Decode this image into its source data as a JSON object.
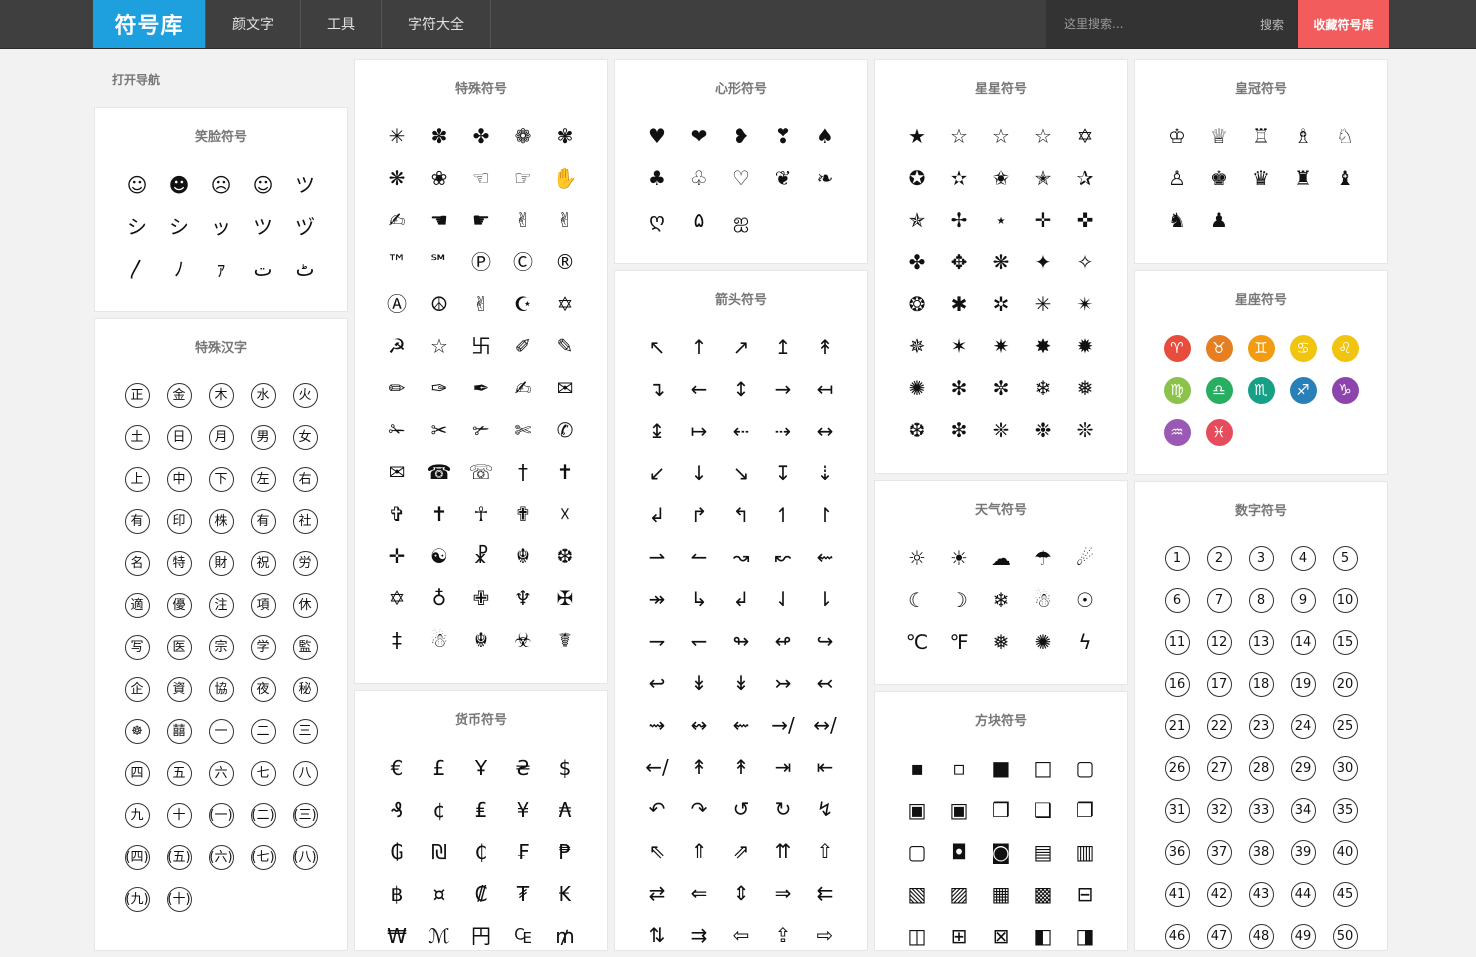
{
  "header": {
    "logo": "符号库",
    "nav": [
      "颜文字",
      "工具",
      "字符大全"
    ],
    "search_placeholder": "这里搜索...",
    "search_button": "搜索",
    "favorite": "收藏符号库"
  },
  "open_nav": "打开导航",
  "colors": {
    "logo_bg": "#1e9fde",
    "favorite_bg": "#f25c5c",
    "topbar_bg": "#3f3f3f",
    "zodiac": [
      "#e74c3c",
      "#e67e22",
      "#f39c12",
      "#f1c40f",
      "#f1c40f",
      "#8bc34a",
      "#27ae60",
      "#16a085",
      "#2980b9",
      "#8e44ad",
      "#9b59b6",
      "#e74c5c"
    ]
  },
  "panels": {
    "smile": {
      "title": "笑脸符号",
      "symbols": [
        "☺",
        "☻",
        "☹",
        "☺",
        "ツ",
        "シ",
        "シ",
        "ッ",
        "ツ",
        "ヅ",
        "〳",
        "ﾉ",
        "ｧ",
        "ت",
        "ٹ"
      ]
    },
    "chinese": {
      "title": "特殊汉字",
      "symbols": [
        "正",
        "金",
        "木",
        "水",
        "火",
        "土",
        "日",
        "月",
        "男",
        "女",
        "上",
        "中",
        "下",
        "左",
        "右",
        "有",
        "印",
        "株",
        "有",
        "社",
        "名",
        "特",
        "財",
        "祝",
        "労",
        "適",
        "優",
        "注",
        "項",
        "休",
        "写",
        "医",
        "宗",
        "学",
        "監",
        "企",
        "資",
        "協",
        "夜",
        "秘",
        "☸",
        "囍",
        "一",
        "二",
        "三",
        "四",
        "五",
        "六",
        "七",
        "八",
        "九",
        "十",
        "(一)",
        "(二)",
        "(三)",
        "(四)",
        "(五)",
        "(六)",
        "(七)",
        "(八)",
        "(九)",
        "(十)"
      ]
    },
    "special": {
      "title": "特殊符号",
      "symbols": [
        "✳",
        "✽",
        "✤",
        "❁",
        "✾",
        "❋",
        "❀",
        "☜",
        "☞",
        "✋",
        "✍",
        "☚",
        "☛",
        "✌",
        "✌",
        "™",
        "℠",
        "Ⓟ",
        "Ⓒ",
        "®",
        "Ⓐ",
        "☮",
        "✌",
        "☪",
        "✡",
        "☭",
        "☆",
        "卐",
        "✐",
        "✎",
        "✏",
        "✑",
        "✒",
        "✍",
        "✉",
        "✁",
        "✂",
        "✃",
        "✄",
        "✆",
        "✉",
        "☎",
        "☏",
        "†",
        "✝",
        "✞",
        "✝",
        "☥",
        "✟",
        "☓",
        "✛",
        "☯",
        "☧",
        "☬",
        "❆",
        "✡",
        "♁",
        "✙",
        "♆",
        "✠",
        "‡",
        "☃",
        "☬",
        "☣",
        "☤"
      ]
    },
    "heart": {
      "title": "心形符号",
      "symbols": [
        "♥",
        "❤",
        "❥",
        "❣",
        "♠",
        "♣",
        "♧",
        "♡",
        "❦",
        "❧",
        "ღ",
        "۵",
        "ஐ"
      ]
    },
    "arrow": {
      "title": "箭头符号",
      "symbols": [
        "↖",
        "↑",
        "↗",
        "↥",
        "↟",
        "↴",
        "←",
        "↕",
        "→",
        "↤",
        "↨",
        "↦",
        "⇠",
        "⇢",
        "↔",
        "↙",
        "↓",
        "↘",
        "↧",
        "⇣",
        "↲",
        "↱",
        "↰",
        "↿",
        "↾",
        "⇀",
        "↼",
        "↝",
        "↜",
        "⇜",
        "↠",
        "↳",
        "↲",
        "⇃",
        "⇂",
        "⇁",
        "↽",
        "↬",
        "↫",
        "↪",
        "↩",
        "↡",
        "↡",
        "↣",
        "↢",
        "⇝",
        "↭",
        "⇜",
        "→/",
        "↔/",
        "←/",
        "↟",
        "↟",
        "⇥",
        "⇤",
        "↶",
        "↷",
        "↺",
        "↻",
        "↯",
        "⇖",
        "⇑",
        "⇗",
        "⇈",
        "⇧",
        "⇄",
        "⇐",
        "⇕",
        "⇒",
        "⇇",
        "⇅",
        "⇉",
        "⇦",
        "⇪",
        "⇨"
      ]
    },
    "star": {
      "title": "星星符号",
      "symbols": [
        "★",
        "☆",
        "☆",
        "☆",
        "✡",
        "✪",
        "✫",
        "✬",
        "✭",
        "✰",
        "✯",
        "✢",
        "⋆",
        "✛",
        "✜",
        "✤",
        "✥",
        "❋",
        "✦",
        "✧",
        "❂",
        "✱",
        "✲",
        "✳",
        "✴",
        "✵",
        "✶",
        "✷",
        "✸",
        "✹",
        "✺",
        "✻",
        "✼",
        "❄",
        "❅",
        "❆",
        "❇",
        "❈",
        "❉",
        "❊"
      ]
    },
    "crown": {
      "title": "皇冠符号",
      "symbols": [
        "♔",
        "♕",
        "♖",
        "♗",
        "♘",
        "♙",
        "♚",
        "♛",
        "♜",
        "♝",
        "♞",
        "♟"
      ]
    },
    "zodiac": {
      "title": "星座符号",
      "symbols": [
        "♈",
        "♉",
        "♊",
        "♋",
        "♌",
        "♍",
        "♎",
        "♏",
        "♐",
        "♑",
        "♒",
        "♓"
      ]
    },
    "weather": {
      "title": "天气符号",
      "symbols": [
        "☼",
        "☀",
        "☁",
        "☂",
        "☄",
        "☾",
        "☽",
        "❄",
        "☃",
        "☉",
        "℃",
        "℉",
        "❅",
        "✺",
        "ϟ"
      ]
    },
    "currency": {
      "title": "货币符号",
      "symbols": [
        "€",
        "£",
        "Ұ",
        "₴",
        "$",
        "₰",
        "¢",
        "₤",
        "¥",
        "₳",
        "₲",
        "₪",
        "₵",
        "₣",
        "₱",
        "฿",
        "¤",
        "₡",
        "₮",
        "₭",
        "₩",
        "ℳ",
        "円",
        "₠",
        "₥"
      ]
    },
    "number": {
      "title": "数字符号",
      "symbols": [
        "1",
        "2",
        "3",
        "4",
        "5",
        "6",
        "7",
        "8",
        "9",
        "10",
        "11",
        "12",
        "13",
        "14",
        "15",
        "16",
        "17",
        "18",
        "19",
        "20",
        "21",
        "22",
        "23",
        "24",
        "25",
        "26",
        "27",
        "28",
        "29",
        "30",
        "31",
        "32",
        "33",
        "34",
        "35",
        "36",
        "37",
        "38",
        "39",
        "40",
        "41",
        "42",
        "43",
        "44",
        "45",
        "46",
        "47",
        "48",
        "49",
        "50"
      ]
    },
    "block": {
      "title": "方块符号",
      "symbols": [
        "▪",
        "▫",
        "■",
        "□",
        "▢",
        "▣",
        "▣",
        "❒",
        "❑",
        "❐",
        "▢",
        "◘",
        "◙",
        "▤",
        "▥",
        "▧",
        "▨",
        "▦",
        "▩",
        "⊟",
        "◫",
        "⊞",
        "⊠",
        "◧",
        "◨"
      ]
    }
  }
}
